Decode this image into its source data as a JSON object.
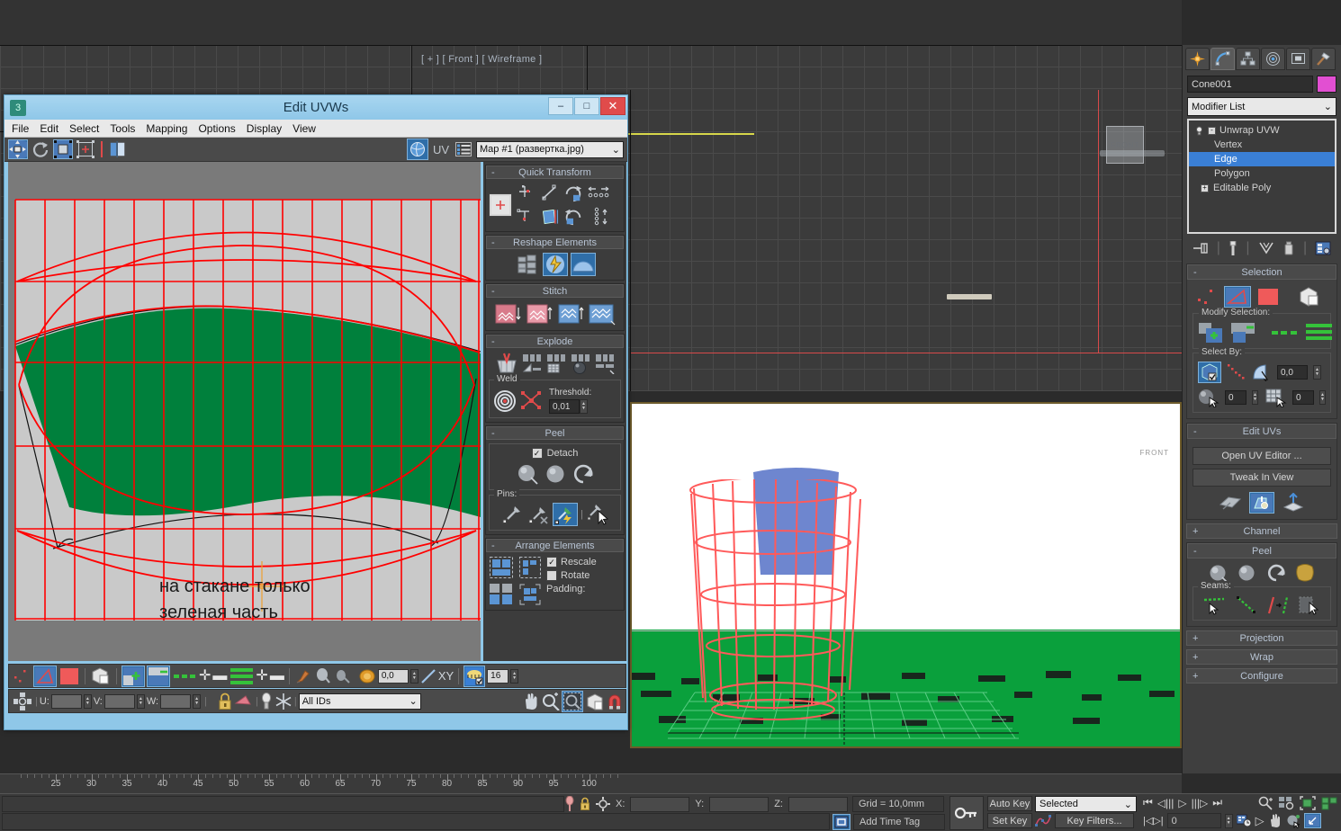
{
  "app": {
    "viewport_top_label": "[ + ] [ Front ] [ Wireframe ]",
    "viewcube_face": "FRONT",
    "viewport_bottom_label": "FRONT"
  },
  "command_panel": {
    "tabs": [
      {
        "name": "create-tab",
        "icon": "star-icon"
      },
      {
        "name": "modify-tab",
        "icon": "curve-icon"
      },
      {
        "name": "hierarchy-tab",
        "icon": "hierarchy-icon"
      },
      {
        "name": "motion-tab",
        "icon": "motion-icon"
      },
      {
        "name": "display-tab",
        "icon": "display-icon"
      },
      {
        "name": "utilities-tab",
        "icon": "hammer-icon"
      }
    ],
    "object_name": "Cone001",
    "object_color": "#e24fd2",
    "modifier_list_label": "Modifier List",
    "modifier_stack": [
      {
        "label": "Unwrap UVW",
        "level": 0,
        "selected": false,
        "toggle": "-"
      },
      {
        "label": "Vertex",
        "level": 1,
        "selected": false
      },
      {
        "label": "Edge",
        "level": 1,
        "selected": true
      },
      {
        "label": "Polygon",
        "level": 1,
        "selected": false
      },
      {
        "label": "Editable Poly",
        "level": 0,
        "selected": false,
        "toggle": "+"
      }
    ],
    "rollouts": {
      "selection": {
        "title": "Selection",
        "expanded": true,
        "modify_selection_label": "Modify Selection:",
        "select_by_label": "Select By:",
        "angle_value": "0,0",
        "material_id_value": "0",
        "smoothing_group_value": "0"
      },
      "edit_uvs": {
        "title": "Edit UVs",
        "expanded": true,
        "open_uv_editor_label": "Open UV Editor ...",
        "tweak_in_view_label": "Tweak In View"
      },
      "channel": {
        "title": "Channel",
        "expanded": false
      },
      "peel": {
        "title": "Peel",
        "expanded": true,
        "seams_label": "Seams:"
      },
      "projection": {
        "title": "Projection",
        "expanded": false
      },
      "wrap": {
        "title": "Wrap",
        "expanded": false
      },
      "configure": {
        "title": "Configure",
        "expanded": false
      }
    }
  },
  "edit_uvws": {
    "title": "Edit UVWs",
    "window_buttons": {
      "minimize": "–",
      "maximize": "□",
      "close": "✕"
    },
    "menu": [
      "File",
      "Edit",
      "Select",
      "Tools",
      "Mapping",
      "Options",
      "Display",
      "View"
    ],
    "toolbar": {
      "uv_label": "UV",
      "map_dropdown_value": "Map #1 (развертка.jpg)"
    },
    "canvas": {
      "annotation_line1": "на стакане только",
      "annotation_line2": "зеленая часть",
      "green_color": "#00803c",
      "wire_color": "#ff0000",
      "background_color": "#c8c8c8"
    },
    "rollouts": {
      "quick_transform": {
        "title": "Quick Transform"
      },
      "reshape_elements": {
        "title": "Reshape Elements"
      },
      "stitch": {
        "title": "Stitch"
      },
      "explode": {
        "title": "Explode",
        "weld_label": "Weld",
        "threshold_label": "Threshold:",
        "threshold_value": "0,01"
      },
      "peel": {
        "title": "Peel",
        "detach_label": "Detach",
        "detach_checked": true,
        "pins_label": "Pins:"
      },
      "arrange_elements": {
        "title": "Arrange Elements",
        "rescale_label": "Rescale",
        "rescale_checked": true,
        "rotate_label": "Rotate",
        "rotate_checked": false,
        "padding_label": "Padding:"
      }
    },
    "bottom_toolbar": {
      "falloff_value": "0,0",
      "xy_label": "XY",
      "grid_value": "16",
      "u_label": "U:",
      "v_label": "V:",
      "w_label": "W:",
      "u_value": "",
      "v_value": "",
      "w_value": "",
      "ids_dropdown_value": "All IDs"
    }
  },
  "timeline": {
    "ticks": [
      25,
      30,
      35,
      40,
      45,
      50,
      55,
      60,
      65,
      70,
      75,
      80,
      85,
      90,
      95,
      100
    ]
  },
  "status_bar": {
    "x_label": "X:",
    "y_label": "Y:",
    "z_label": "Z:",
    "x_value": "",
    "y_value": "",
    "z_value": "",
    "grid_text": "Grid = 10,0mm",
    "add_time_tag": "Add Time Tag",
    "auto_key": "Auto Key",
    "set_key": "Set Key",
    "key_mode_value": "Selected",
    "key_filters": "Key Filters...",
    "frame_value": "0"
  }
}
